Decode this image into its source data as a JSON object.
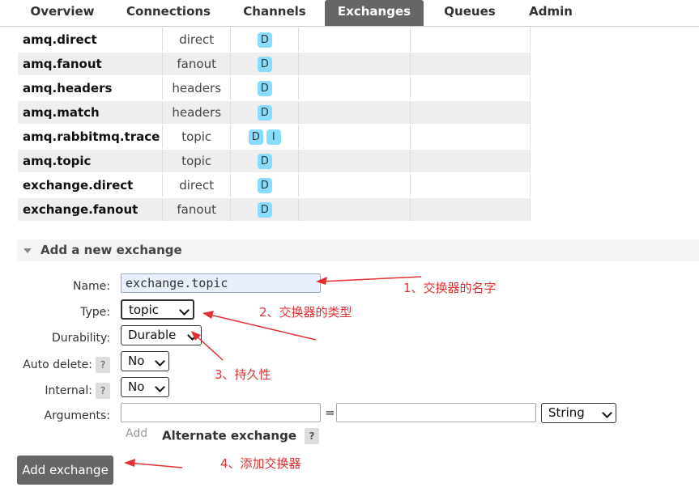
{
  "nav": {
    "tabs": [
      {
        "label": "Overview",
        "active": false
      },
      {
        "label": "Connections",
        "active": false
      },
      {
        "label": "Channels",
        "active": false
      },
      {
        "label": "Exchanges",
        "active": true
      },
      {
        "label": "Queues",
        "active": false
      },
      {
        "label": "Admin",
        "active": false
      }
    ]
  },
  "exchanges": [
    {
      "name": "amq.direct",
      "type": "direct",
      "features": [
        "D"
      ]
    },
    {
      "name": "amq.fanout",
      "type": "fanout",
      "features": [
        "D"
      ]
    },
    {
      "name": "amq.headers",
      "type": "headers",
      "features": [
        "D"
      ]
    },
    {
      "name": "amq.match",
      "type": "headers",
      "features": [
        "D"
      ]
    },
    {
      "name": "amq.rabbitmq.trace",
      "type": "topic",
      "features": [
        "D",
        "I"
      ]
    },
    {
      "name": "amq.topic",
      "type": "topic",
      "features": [
        "D"
      ]
    },
    {
      "name": "exchange.direct",
      "type": "direct",
      "features": [
        "D"
      ]
    },
    {
      "name": "exchange.fanout",
      "type": "fanout",
      "features": [
        "D"
      ]
    }
  ],
  "form": {
    "section_title": "Add a new exchange",
    "name_label": "Name:",
    "name_value": "exchange.topic",
    "type_label": "Type:",
    "type_value": "topic",
    "durability_label": "Durability:",
    "durability_value": "Durable",
    "auto_delete_label": "Auto delete:",
    "auto_delete_value": "No",
    "internal_label": "Internal:",
    "internal_value": "No",
    "arguments_label": "Arguments:",
    "arguments_equals": "=",
    "arguments_type_value": "String",
    "help_mark": "?",
    "add_link": "Add",
    "alternate_exchange": "Alternate exchange",
    "submit_label": "Add exchange"
  },
  "annotations": {
    "a1": "1、交换器的名字",
    "a2": "2、交换器的类型",
    "a3": "3、持久性",
    "a4": "4、添加交换器"
  },
  "colors": {
    "active_tab": "#666666",
    "badge": "#88ddff",
    "annotation": "#e03030",
    "button": "#666666"
  }
}
